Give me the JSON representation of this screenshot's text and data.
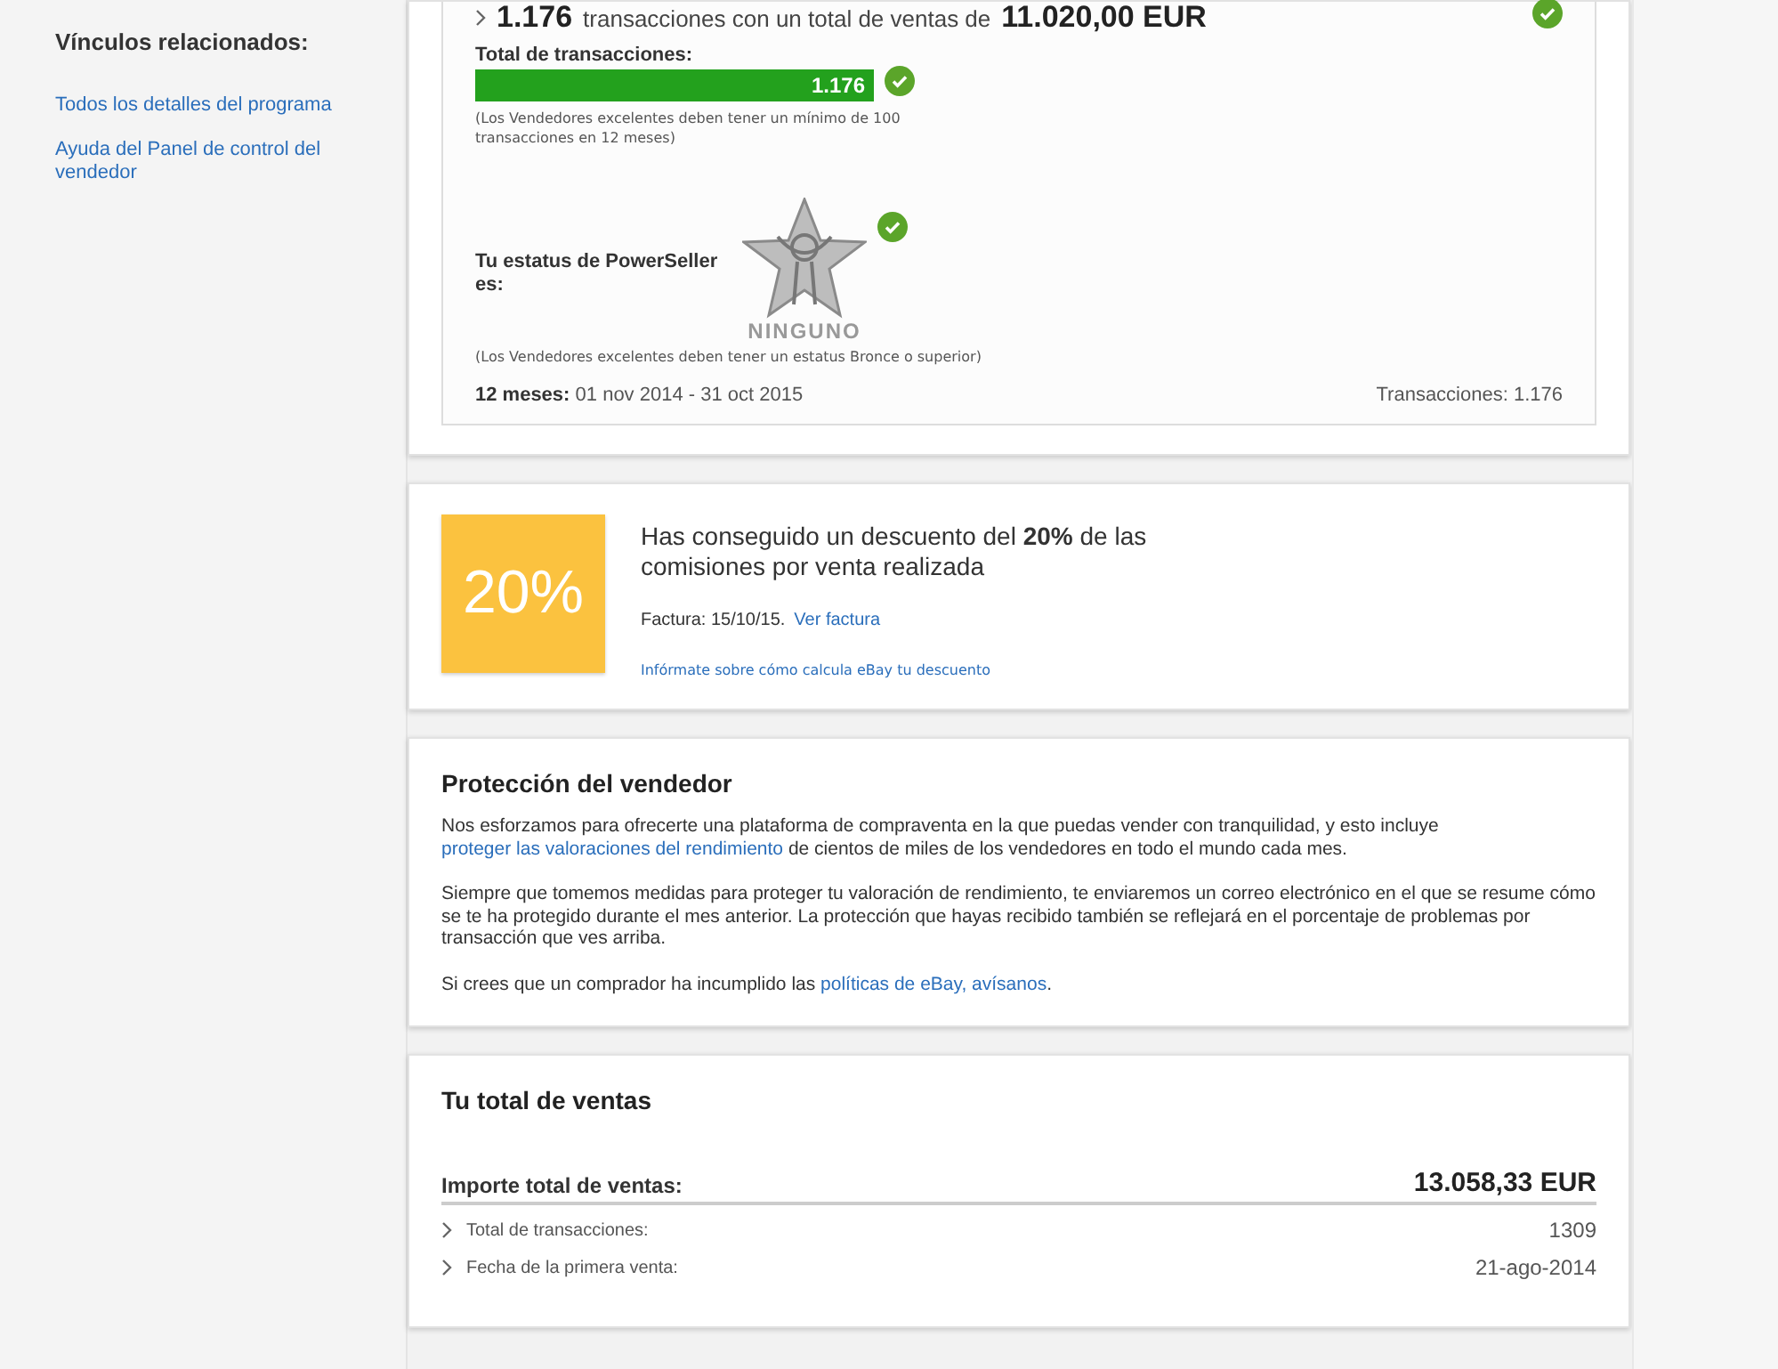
{
  "sidebar": {
    "title": "Vínculos relacionados:",
    "links": [
      "Todos los detalles del programa",
      "Ayuda del Panel de control del vendedor"
    ]
  },
  "performance": {
    "summary": {
      "count": "1.176",
      "text": "transacciones con un total de ventas de",
      "amount": "11.020,00 EUR",
      "met": true
    },
    "transactions": {
      "label": "Total de transacciones:",
      "value": "1.176",
      "level": 1,
      "met": true,
      "note": "(Los Vendedores excelentes deben tener un mínimo de 100 transacciones en 12 meses)"
    },
    "powerseller": {
      "label": "Tu estatus de PowerSeller es:",
      "status": "NINGUNO",
      "met": true,
      "note": "(Los Vendedores excelentes deben tener un estatus Bronce o superior)"
    },
    "period": {
      "label": "12 meses:",
      "value": "01 nov 2014 - 31 oct 2015"
    },
    "total": "Transacciones: 1.176"
  },
  "discount": {
    "badge": "20%",
    "headline": "Has conseguido un descuento del **20%** de las comisiones por venta realizada",
    "invoice": "Factura: 15/10/15.",
    "invoice_link": "Ver factura",
    "info_link": "Infórmate sobre cómo calcula eBay tu descuento"
  },
  "protection": {
    "title": "Protección del vendedor",
    "paragraphs": [
      [
        {
          "text": "Nos esforzamos para ofrecerte una plataforma de compraventa en la que puedas vender con tranquilidad, y esto incluye ",
          "link": false
        },
        {
          "text": "proteger las valoraciones del rendimiento",
          "link": true
        },
        {
          "text": " de cientos de miles de los vendedores en todo el mundo cada mes.",
          "link": false
        }
      ],
      [
        {
          "text": "Siempre que tomemos medidas para proteger tu valoración de rendimiento, te enviaremos un correo electrónico en el que se resume cómo se te ha protegido durante el mes anterior. La protección que hayas recibido también se reflejará en el porcentaje de problemas por transacción que ves arriba.",
          "link": false
        }
      ],
      [
        {
          "text": "Si crees que un comprador ha incumplido las ",
          "link": false
        },
        {
          "text": "políticas de eBay, avísanos",
          "link": true
        },
        {
          "text": ".",
          "link": false
        }
      ]
    ]
  },
  "sales": {
    "title": "Tu total de ventas",
    "total_label": "Importe total de ventas:",
    "total_value": "13.058,33 EUR",
    "rows": [
      {
        "label": "Total de transacciones:",
        "value": "1309"
      },
      {
        "label": "Fecha de la primera venta:",
        "value": "21-ago-2014"
      }
    ]
  }
}
